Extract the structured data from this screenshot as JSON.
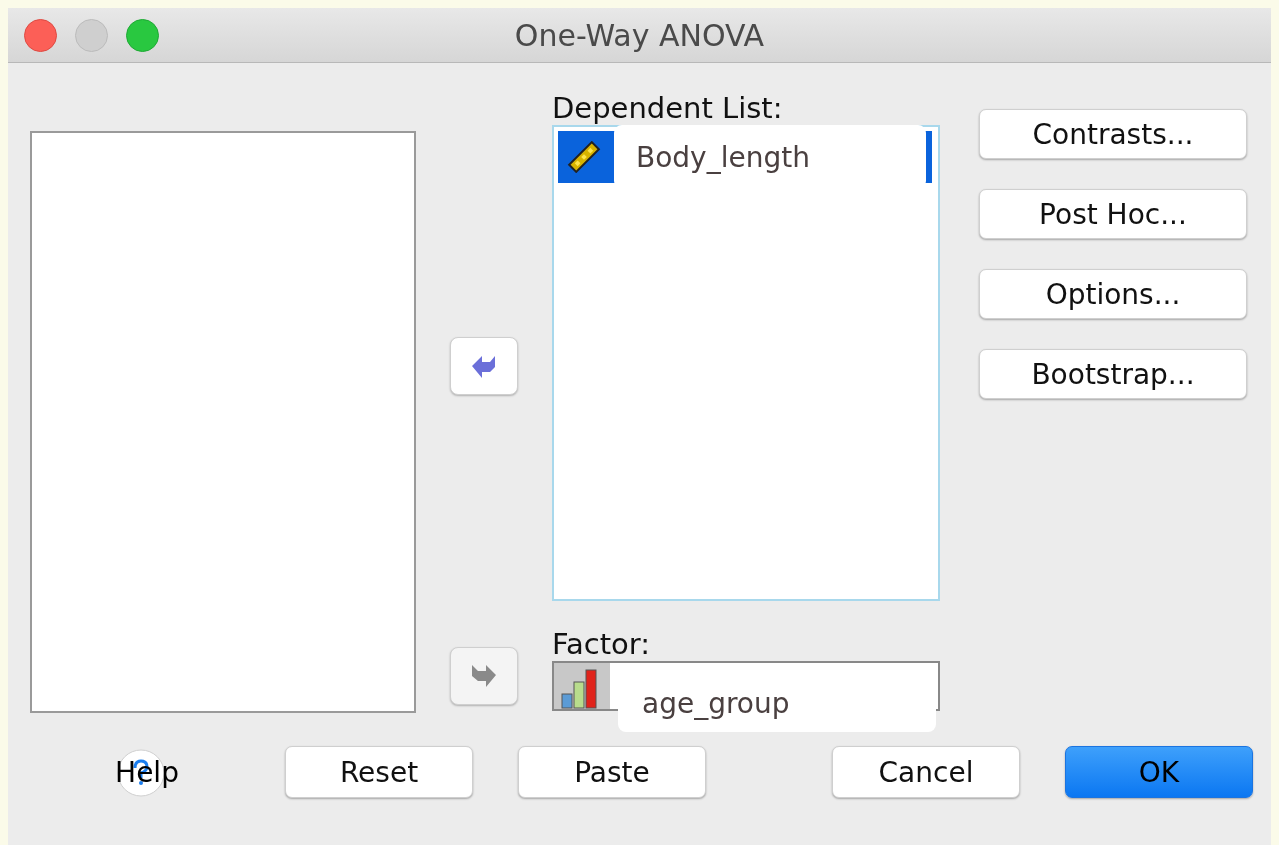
{
  "window": {
    "title": "One-Way ANOVA"
  },
  "move_buttons": [
    {
      "kind": "dependent",
      "disabled": false
    },
    {
      "kind": "factor",
      "disabled": true
    }
  ],
  "dependent_list": {
    "label": "Dependent List:",
    "items": [
      {
        "name": "Body_length",
        "selected": true
      }
    ]
  },
  "factor": {
    "label": "Factor:",
    "value": "age_group"
  },
  "side_buttons": [
    "Contrasts...",
    "Post Hoc...",
    "Options...",
    "Bootstrap..."
  ],
  "bottom_buttons": [
    {
      "kind": "help",
      "label": "Help"
    },
    {
      "kind": "normal",
      "label": "Reset"
    },
    {
      "kind": "normal",
      "label": "Paste"
    },
    {
      "kind": "normal",
      "label": "Cancel"
    },
    {
      "kind": "default",
      "label": "OK"
    }
  ]
}
